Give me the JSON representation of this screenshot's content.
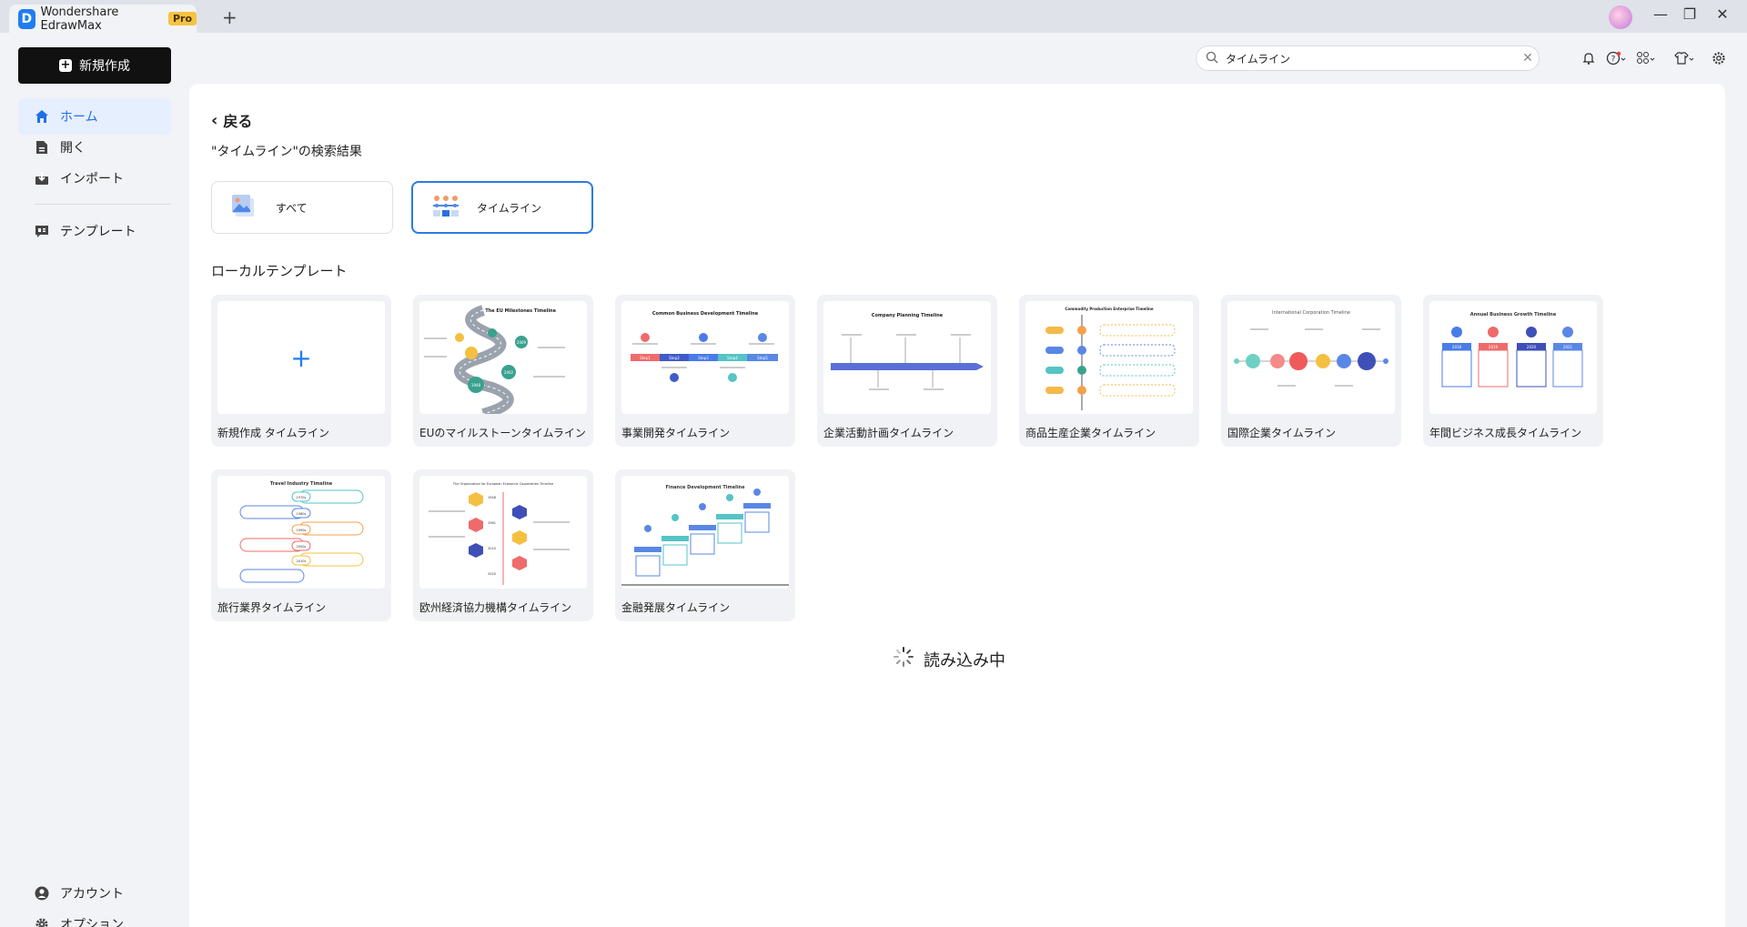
{
  "app": {
    "name": "Wondershare EdrawMax",
    "badge": "Pro",
    "new_tab_symbol": "+"
  },
  "window_controls": {
    "minimize": "—",
    "restore": "❐",
    "close": "✕"
  },
  "sidebar": {
    "new_button": "新規作成",
    "items": [
      {
        "label": "ホーム",
        "icon": "home-icon",
        "active": true
      },
      {
        "label": "開く",
        "icon": "file-icon"
      },
      {
        "label": "インポート",
        "icon": "import-icon"
      },
      {
        "label": "テンプレート",
        "icon": "template-icon"
      }
    ],
    "bottom": [
      {
        "label": "アカウント",
        "icon": "account-icon"
      },
      {
        "label": "オプション",
        "icon": "gear-icon"
      }
    ]
  },
  "search": {
    "value": "タイムライン",
    "clear": "✕"
  },
  "main": {
    "back": "戻る",
    "result_title": "\"タイムライン\"の検索結果",
    "filters": [
      {
        "label": "すべて",
        "icon": "all-icon",
        "active": false
      },
      {
        "label": "タイムライン",
        "icon": "timeline-icon",
        "active": true
      }
    ],
    "section_title": "ローカルテンプレート",
    "cards": [
      {
        "label": "新規作成 タイムライン",
        "kind": "new"
      },
      {
        "label": "EUのマイルストーンタイムライン",
        "kind": "eu",
        "thumb_title": "The EU Milestones Timeline",
        "thumb_text": [
          "1948",
          "2002",
          "2009"
        ]
      },
      {
        "label": "事業開発タイムライン",
        "kind": "biz",
        "thumb_title": "Common Business Development Timeline",
        "thumb_text": [
          "Step1",
          "Step2",
          "Step3",
          "Step4",
          "Step5"
        ]
      },
      {
        "label": "企業活動計画タイムライン",
        "kind": "plan",
        "thumb_title": "Company Planning Timeline"
      },
      {
        "label": "商品生産企業タイムライン",
        "kind": "commodity",
        "thumb_title": "Commodity Production Enterprise Timeline"
      },
      {
        "label": "国際企業タイムライン",
        "kind": "intl",
        "thumb_title": "International Corporation Timeline"
      },
      {
        "label": "年間ビジネス成長タイムライン",
        "kind": "annual",
        "thumb_title": "Annual Business Growth Timeline",
        "thumb_text": [
          "2018",
          "2019",
          "2020",
          "2021"
        ]
      },
      {
        "label": "旅行業界タイムライン",
        "kind": "travel",
        "thumb_title": "Travel Industry Timeline",
        "thumb_text": [
          "1970s",
          "1980s",
          "1990s",
          "2000s",
          "2010s"
        ]
      },
      {
        "label": "欧州経済協力機構タイムライン",
        "kind": "oeec",
        "thumb_title": "The Organization for European Economic Cooperation Timeline",
        "thumb_text": [
          "1948",
          "1961",
          "2010",
          "2020"
        ]
      },
      {
        "label": "金融発展タイムライン",
        "kind": "finance",
        "thumb_title": "Finance Development Timeline"
      }
    ],
    "loading": "読み込み中"
  },
  "colors": {
    "accent": "#1f7df2",
    "active_nav_bg": "#e6effd",
    "new_button_bg": "#111111"
  }
}
